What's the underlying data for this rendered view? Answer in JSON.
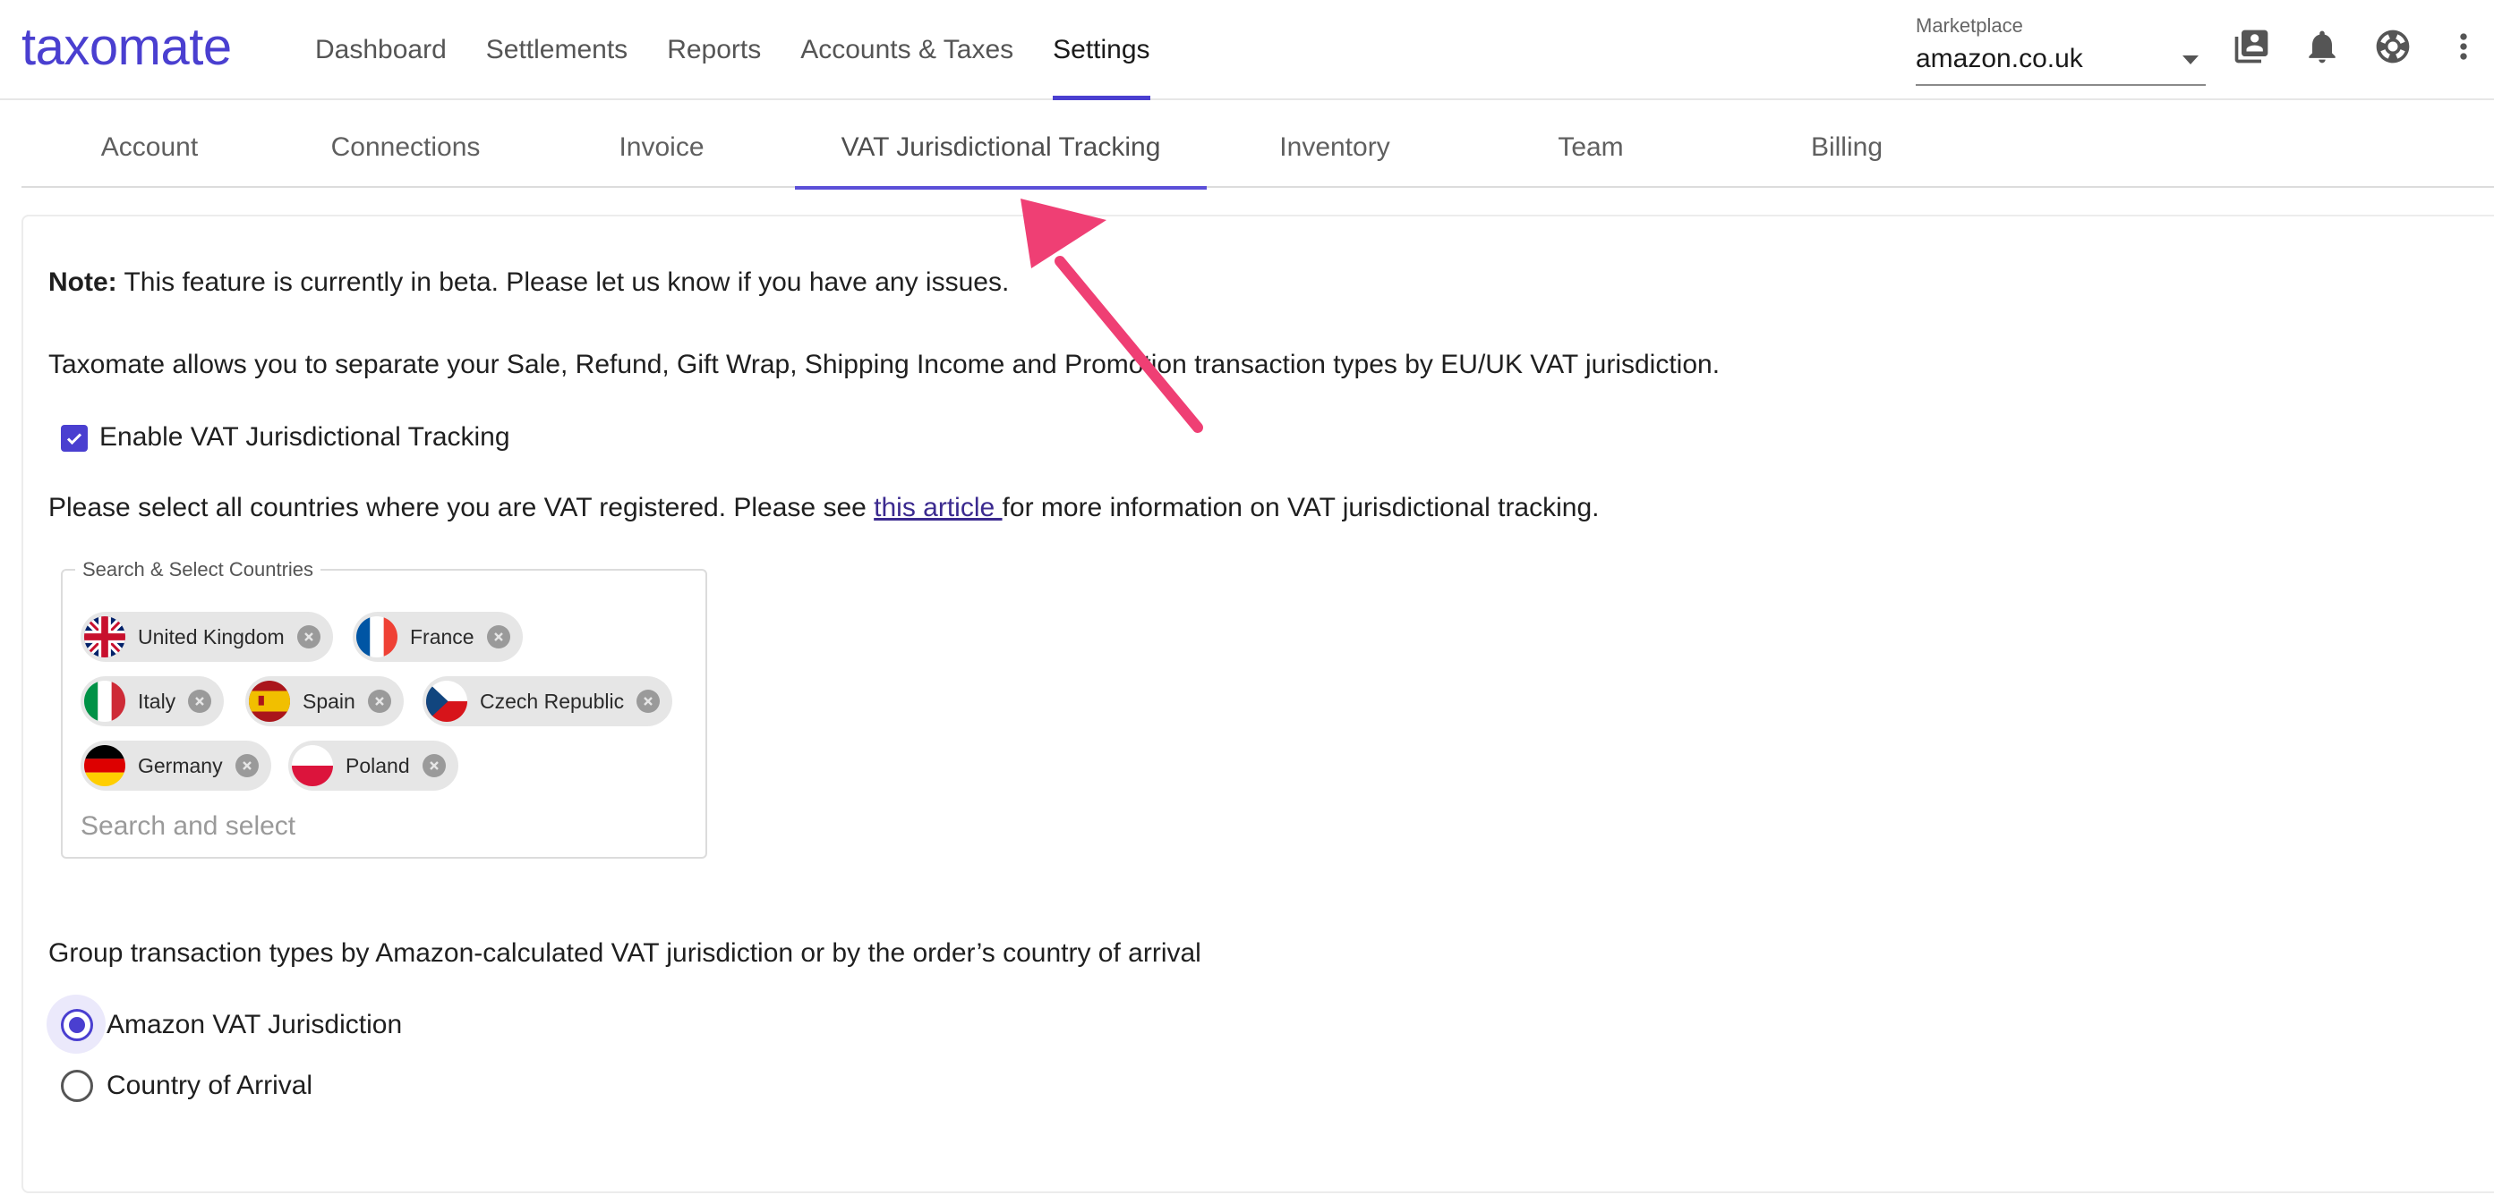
{
  "app": {
    "logo": "taxomate",
    "brand_color": "#4a3fd0"
  },
  "nav": {
    "items": [
      {
        "label": "Dashboard",
        "active": false
      },
      {
        "label": "Settlements",
        "active": false
      },
      {
        "label": "Reports",
        "active": false
      },
      {
        "label": "Accounts & Taxes",
        "active": false
      },
      {
        "label": "Settings",
        "active": true
      }
    ]
  },
  "marketplace": {
    "label": "Marketplace",
    "value": "amazon.co.uk"
  },
  "header_icons": [
    "contacts-icon",
    "bell-icon",
    "help-lifebuoy-icon",
    "more-vertical-icon"
  ],
  "tabs": [
    {
      "label": "Account"
    },
    {
      "label": "Connections"
    },
    {
      "label": "Invoice"
    },
    {
      "label": "VAT Jurisdictional Tracking",
      "active": true
    },
    {
      "label": "Inventory"
    },
    {
      "label": "Team"
    },
    {
      "label": "Billing"
    }
  ],
  "content": {
    "note_label": "Note:",
    "note_text": " This feature is currently in beta. Please let us know if you have any issues.",
    "intro": "Taxomate allows you to separate your Sale, Refund, Gift Wrap, Shipping Income and Promotion transaction types by EU/UK VAT jurisdiction.",
    "enable_label": "Enable VAT Jurisdictional Tracking",
    "enable_checked": true,
    "select_before": "Please select all countries where you are VAT registered. Please see ",
    "select_link": "this article ",
    "select_after": "for more information on VAT jurisdictional tracking.",
    "selector_label": "Search & Select Countries",
    "selector_placeholder": "Search and select",
    "countries": [
      "United Kingdom",
      "France",
      "Italy",
      "Spain",
      "Czech Republic",
      "Germany",
      "Poland"
    ],
    "group_text": "Group transaction types by Amazon-calculated VAT jurisdiction or by the order’s country of arrival",
    "radio_options": [
      {
        "label": "Amazon VAT Jurisdiction",
        "checked": true
      },
      {
        "label": "Country of Arrival",
        "checked": false
      }
    ]
  },
  "annotation": {
    "arrow_color": "#ef3f74"
  }
}
